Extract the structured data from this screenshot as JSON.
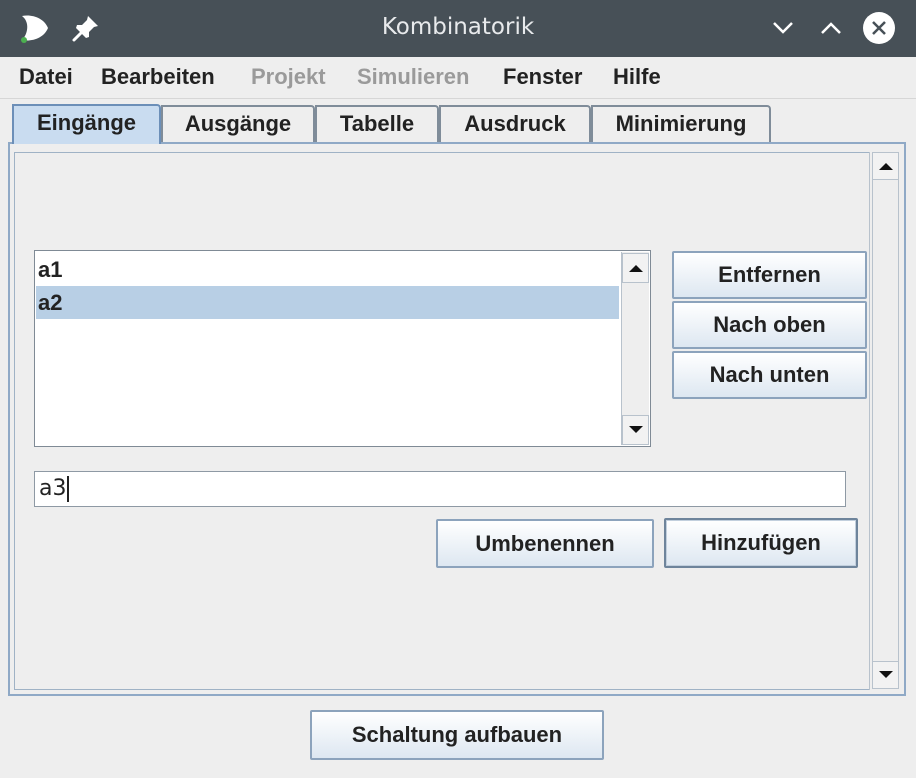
{
  "window": {
    "title": "Kombinatorik"
  },
  "menu": {
    "items": [
      {
        "label": "Datei",
        "enabled": true
      },
      {
        "label": "Bearbeiten",
        "enabled": true
      },
      {
        "label": "Projekt",
        "enabled": false
      },
      {
        "label": "Simulieren",
        "enabled": false
      },
      {
        "label": "Fenster",
        "enabled": true
      },
      {
        "label": "Hilfe",
        "enabled": true
      }
    ]
  },
  "tabs": [
    {
      "label": "Eingänge",
      "active": true
    },
    {
      "label": "Ausgänge",
      "active": false
    },
    {
      "label": "Tabelle",
      "active": false
    },
    {
      "label": "Ausdruck",
      "active": false
    },
    {
      "label": "Minimierung",
      "active": false
    }
  ],
  "inputs_list": {
    "items": [
      {
        "label": "a1",
        "selected": false
      },
      {
        "label": "a2",
        "selected": true
      }
    ]
  },
  "side_buttons": {
    "remove": "Entfernen",
    "move_up": "Nach oben",
    "move_down": "Nach unten"
  },
  "name_field": {
    "value": "a3"
  },
  "action_buttons": {
    "rename": "Umbenennen",
    "add": "Hinzufügen"
  },
  "footer": {
    "build_circuit": "Schaltung aufbauen"
  },
  "colors": {
    "titlebar": "#475057",
    "selection": "#b8cfe5",
    "active_tab": "#c9dcf0"
  }
}
